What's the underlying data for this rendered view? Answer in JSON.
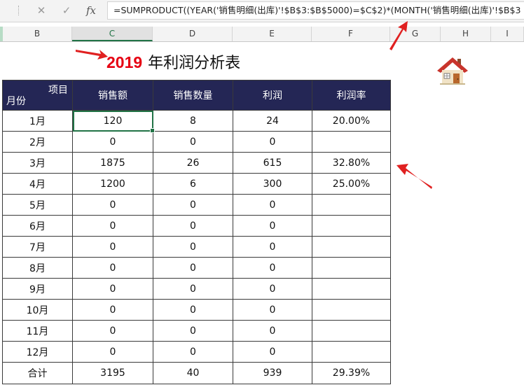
{
  "formula_bar": {
    "cancel_glyph": "✕",
    "confirm_glyph": "✓",
    "fx_label": "fx",
    "formula": "=SUMPRODUCT((YEAR('销售明细(出库)'!$B$3:$B$5000)=$C$2)*(MONTH('销售明细(出库)'!$B$3"
  },
  "columns": {
    "headers": [
      "B",
      "C",
      "D",
      "E",
      "F",
      "G",
      "H",
      "I"
    ],
    "selected": "C"
  },
  "title": {
    "year": "2019",
    "text": "年利润分析表"
  },
  "table": {
    "corner_top": "项目",
    "corner_bottom": "月份",
    "headers": [
      "销售额",
      "销售数量",
      "利润",
      "利润率"
    ],
    "rows": [
      [
        "1月",
        "120",
        "8",
        "24",
        "20.00%"
      ],
      [
        "2月",
        "0",
        "0",
        "0",
        ""
      ],
      [
        "3月",
        "1875",
        "26",
        "615",
        "32.80%"
      ],
      [
        "4月",
        "1200",
        "6",
        "300",
        "25.00%"
      ],
      [
        "5月",
        "0",
        "0",
        "0",
        ""
      ],
      [
        "6月",
        "0",
        "0",
        "0",
        ""
      ],
      [
        "7月",
        "0",
        "0",
        "0",
        ""
      ],
      [
        "8月",
        "0",
        "0",
        "0",
        ""
      ],
      [
        "9月",
        "0",
        "0",
        "0",
        ""
      ],
      [
        "10月",
        "0",
        "0",
        "0",
        ""
      ],
      [
        "11月",
        "0",
        "0",
        "0",
        ""
      ],
      [
        "12月",
        "0",
        "0",
        "0",
        ""
      ],
      [
        "合计",
        "3195",
        "40",
        "939",
        "29.39%"
      ]
    ],
    "active_cell": "C1",
    "header_bg": "#242655"
  },
  "colors": {
    "accent": "#217346",
    "arrow": "#e02020",
    "year": "#e60012"
  },
  "icons": {
    "house": "house-icon"
  }
}
